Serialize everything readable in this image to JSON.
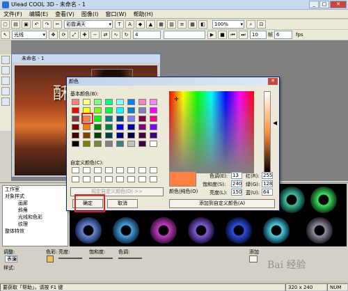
{
  "app": {
    "title": "Ulead COOL 3D - 未命名 - 1"
  },
  "menu": [
    "文件(F)",
    "编辑(E)",
    "查看(V)",
    "图像(I)",
    "窗口(W)",
    "帮助(H)"
  ],
  "toolbar1": {
    "preset_combo": "彩霞满天",
    "zoom_combo": "100%"
  },
  "toolbar2": {
    "line_combo": "光线",
    "frame_value": "4",
    "frame_value2": "10",
    "frame_label": "帧",
    "total_frames": "6",
    "fps_label": "fps"
  },
  "docwindow": {
    "title": "未命名 - 1",
    "glyph": "酥"
  },
  "dialog": {
    "title": "颜色",
    "basic_label": "基本颜色(B):",
    "custom_label": "自定义颜色(C):",
    "define_button": "规定自定义颜色(D) >>",
    "ok_button": "确定",
    "cancel_button": "取消",
    "color_solid_label": "颜色|纯色(O)",
    "add_custom_button": "添加到自定义颜色(A)",
    "hue_label": "色调(E):",
    "hue": "13",
    "sat_label": "饱和度(S):",
    "sat": "240",
    "lum_label": "亮度(L):",
    "lum": "150",
    "red_label": "红(R):",
    "red": "255",
    "green_label": "绿(G):",
    "green": "128",
    "blue_label": "蓝(U):",
    "blue": "64",
    "basic_colors": [
      "#ff8080",
      "#ffff80",
      "#80ff80",
      "#00ff80",
      "#80ffff",
      "#0080ff",
      "#ff80c0",
      "#ff80ff",
      "#ff0000",
      "#ffff00",
      "#80ff00",
      "#00ff40",
      "#00ffff",
      "#0080c0",
      "#8080c0",
      "#ff00ff",
      "#804040",
      "#ff8040",
      "#00ff00",
      "#008080",
      "#004080",
      "#8080ff",
      "#800040",
      "#ff0080",
      "#800000",
      "#ff8000",
      "#008000",
      "#008040",
      "#0000ff",
      "#0000a0",
      "#800080",
      "#8000ff",
      "#400000",
      "#804000",
      "#004000",
      "#004040",
      "#000080",
      "#000040",
      "#400040",
      "#400080",
      "#000000",
      "#808000",
      "#808040",
      "#808080",
      "#408080",
      "#c0c0c0",
      "#400040",
      "#ffffff"
    ],
    "accent": "#ff8040"
  },
  "tree": {
    "items": [
      "工作室",
      "对象样式",
      "画廊",
      "斜角",
      "光线和色彩",
      "纹理",
      "整体特效"
    ]
  },
  "controls": {
    "adjust_label": "调整:",
    "surface_combo": "表面",
    "color_label": "色彩:",
    "brightness_label": "亮度:",
    "saturation_label": "饱和度:",
    "hue_label": "色调:",
    "add_label": "添加",
    "style_label": "样式:"
  },
  "status": {
    "help_text": "要获取「帮助」，请按 F1 键",
    "size": "320 x 240",
    "num": "NUM"
  },
  "watermark": "Bai 经验"
}
